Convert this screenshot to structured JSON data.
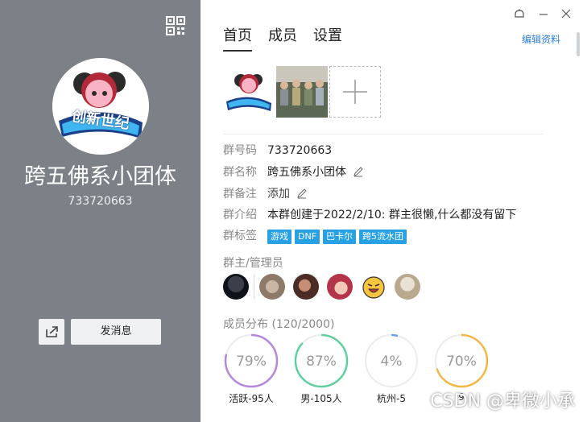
{
  "group": {
    "name": "跨五佛系小团体",
    "number": "733720663",
    "avatar_text": "创新世纪"
  },
  "left_panel": {
    "send_message_label": "发消息"
  },
  "tabs": [
    "首页",
    "成员",
    "设置"
  ],
  "edit_profile_label": "编辑资料",
  "info": {
    "number_label": "群号码",
    "number_value": "733720663",
    "name_label": "群名称",
    "name_value": "跨五佛系小团体",
    "remark_label": "群备注",
    "remark_value": "添加",
    "intro_label": "群介绍",
    "intro_value": "本群创建于2022/2/10:  群主很懒,什么都没有留下",
    "tags_label": "群标签"
  },
  "tags": [
    "游戏",
    "DNF",
    "巴卡尔",
    "跨5流水团"
  ],
  "admins_title": "群主/管理员",
  "members_title": "成员分布 (120/2000)",
  "distribution": [
    {
      "percent": "79%",
      "value": 0.79,
      "label": "活跃-95人",
      "color": "#b287dd"
    },
    {
      "percent": "87%",
      "value": 0.87,
      "label": "男-105人",
      "color": "#5fcf9e"
    },
    {
      "percent": "4%",
      "value": 0.04,
      "label": "杭州-5",
      "color": "#6fa3e8"
    },
    {
      "percent": "70%",
      "value": 0.7,
      "label": "9",
      "color": "#f1b848"
    }
  ],
  "watermark": "CSDN @卑微小承",
  "colors": {
    "left_bg": "#7b8187",
    "accent_blue": "#2c7fd6",
    "tag_bg": "#28a0e4"
  }
}
